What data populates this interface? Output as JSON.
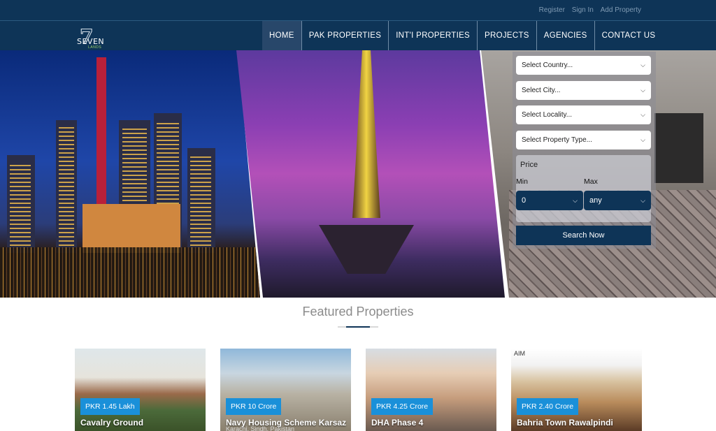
{
  "top_links": [
    "Register",
    "Sign In",
    "Add Property"
  ],
  "logo": {
    "number": "7",
    "word": "SEVEN",
    "sub": "LANDS"
  },
  "nav": [
    "HOME",
    "PAK PROPERTIES",
    "INT'I PROPERTIES",
    "PROJECTS",
    "AGENCIES",
    "CONTACT US"
  ],
  "search": {
    "country": "Select Country...",
    "city": "Select City...",
    "locality": "Select Locality...",
    "property_type": "Select Property Type...",
    "price_label": "Price",
    "min_label": "Min",
    "max_label": "Max",
    "min_value": "0",
    "max_value": "any",
    "button": "Search Now"
  },
  "featured_title": "Featured Properties",
  "cards": [
    {
      "price": "PKR 1.45 Lakh",
      "name": "Cavalry Ground",
      "sub": ""
    },
    {
      "price": "PKR 10 Crore",
      "name": "Navy Housing Scheme Karsaz",
      "sub": "Karachi, Sindh, Pakistan"
    },
    {
      "price": "PKR 4.25 Crore",
      "name": "DHA Phase 4",
      "sub": ""
    },
    {
      "price": "PKR 2.40 Crore",
      "name": "Bahria Town Rawalpindi",
      "sub": "",
      "watermark": "AIM"
    }
  ],
  "colors": {
    "navy": "#0e3457",
    "badge": "#1a90d9"
  },
  "icons": {
    "select": "chevron-down-icon"
  }
}
